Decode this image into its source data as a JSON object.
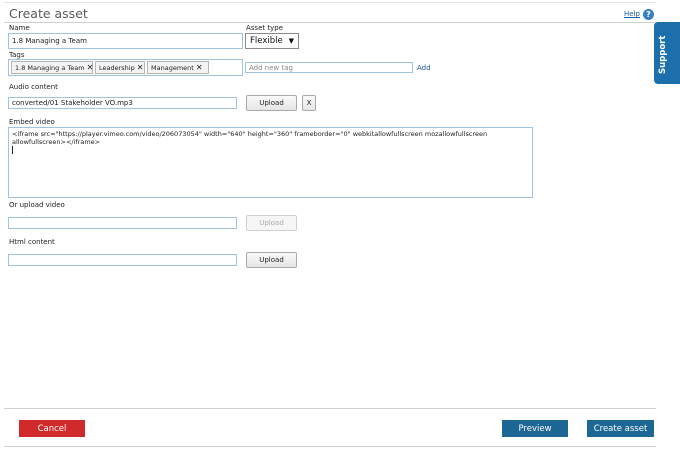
{
  "page": {
    "title": "Create asset",
    "help_label": "Help",
    "help_icon": "?",
    "support_label": "Support"
  },
  "form": {
    "name_label": "Name",
    "name_value": "1.8 Managing a Team",
    "asset_type_label": "Asset type",
    "asset_type_value": "Flexible",
    "tags_label": "Tags",
    "tags": [
      "1.8 Managing a Team",
      "Leadership",
      "Management"
    ],
    "tag_remove_glyph": "✕",
    "new_tag_placeholder": "Add new tag",
    "add_tag_label": "Add",
    "audio_label": "Audio content",
    "audio_value": "converted/01 Stakeholder VO.mp3",
    "upload_label": "Upload",
    "remove_audio_label": "X",
    "embed_label": "Embed video",
    "embed_value": "<iframe src=\"https://player.vimeo.com/video/206073054\" width=\"640\" height=\"360\" frameborder=\"0\" webkitallowfullscreen mozallowfullscreen allowfullscreen></iframe>",
    "upload_video_label": "Or upload video",
    "upload_video_value": "",
    "html_label": "Html content",
    "html_value": ""
  },
  "actions": {
    "cancel_label": "Cancel",
    "preview_label": "Preview",
    "create_label": "Create asset",
    "colors": {
      "cancel": "#d02a2a",
      "primary": "#1d6794",
      "support": "#1d6fab"
    }
  }
}
